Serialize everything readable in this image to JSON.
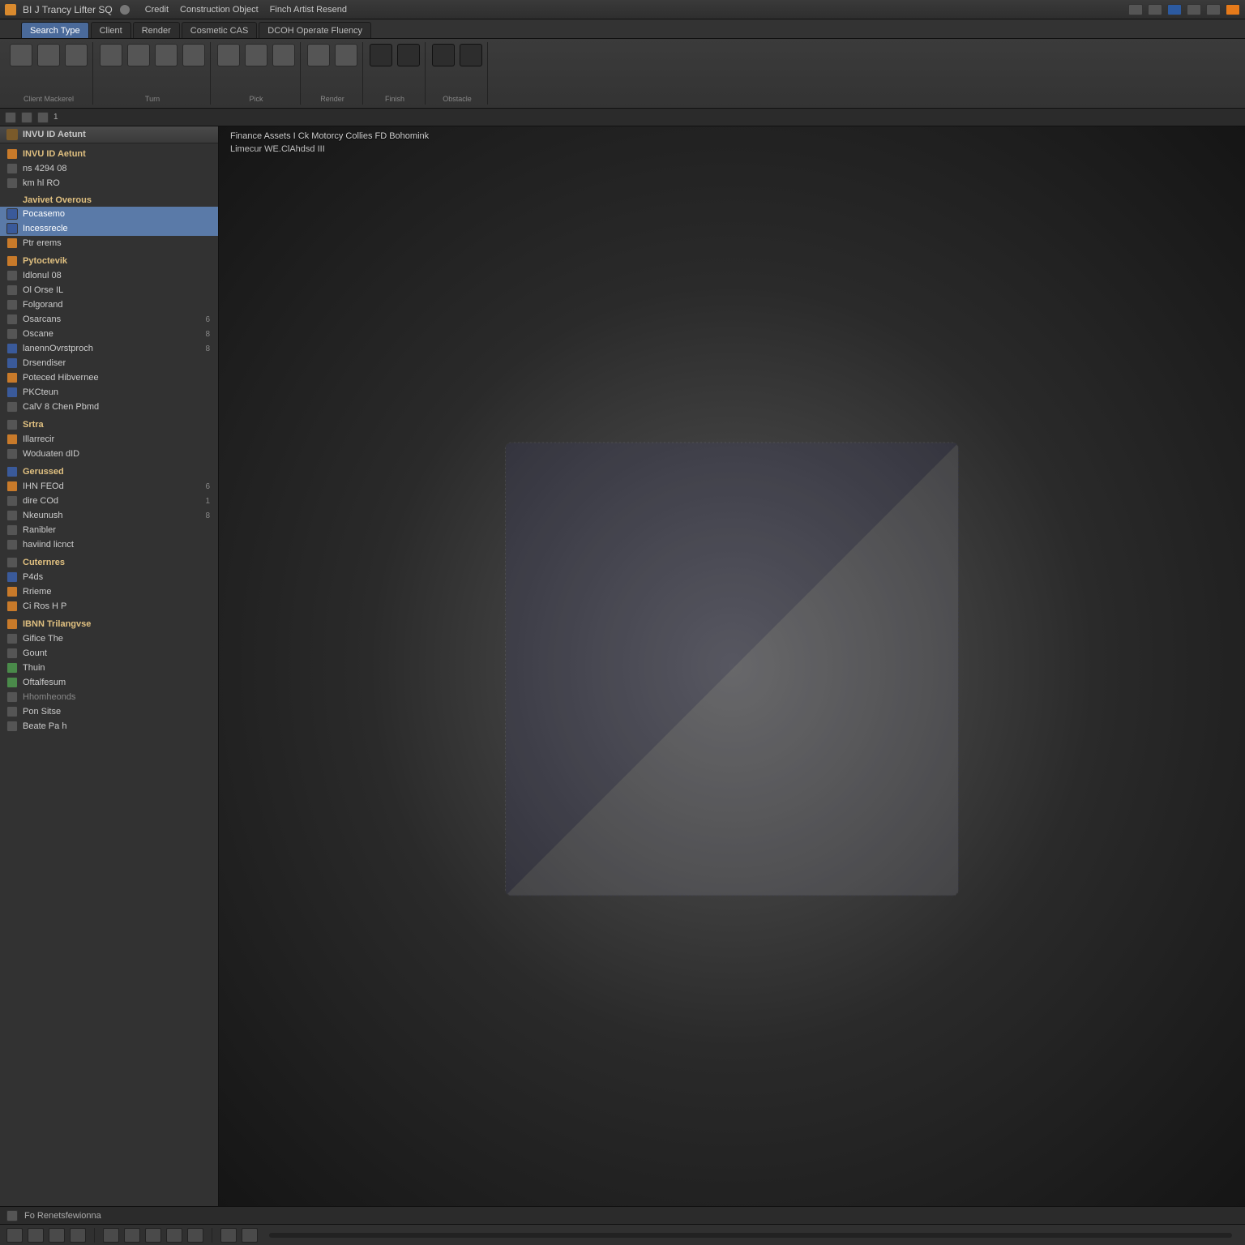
{
  "title_bar": {
    "app_left": "BI J Trancy Lifter SQ",
    "menus": [
      "Credit",
      "Construction Object",
      "Finch Artist Resend"
    ]
  },
  "ribbon_tabs": {
    "tabs": [
      "Search Type",
      "Client",
      "Render",
      "Cosmetic CAS",
      "DCOH Operate Fluency"
    ],
    "active_index": 0
  },
  "ribbon_groups": [
    {
      "label": "Client Mackerel",
      "icons": 3
    },
    {
      "label": "Turn",
      "icons": 4
    },
    {
      "label": "Pick",
      "icons": 3
    },
    {
      "label": "Render",
      "icons": 2
    },
    {
      "label": "Finish",
      "icons": 2
    },
    {
      "label": "Obstacle",
      "icons": 2
    }
  ],
  "sub_header": {
    "crumbs": [
      "1"
    ]
  },
  "viewport": {
    "doc_title": "Finance Assets I Ck Motorcy Collies FD Bohomink",
    "doc_subtitle": "Limecur WE.ClAhdsd III"
  },
  "panel": {
    "header": "INVU ID Aetunt",
    "items": [
      {
        "label": "INVU ID Aetunt",
        "icon": "orange",
        "kind": "header"
      },
      {
        "label": "ns 4294 08",
        "icon": "grey"
      },
      {
        "label": "km hl RO",
        "icon": "grey"
      },
      {
        "label": "Javivet Overous",
        "icon": "none",
        "kind": "section"
      },
      {
        "label": "Pocasemo",
        "icon": "blue",
        "selected": true
      },
      {
        "label": "Incessrecle",
        "icon": "blue",
        "selected": true
      },
      {
        "label": "Ptr erems",
        "icon": "orange"
      },
      {
        "label": "Pytoctevik",
        "icon": "orange",
        "kind": "section"
      },
      {
        "label": "Idlonul 08",
        "icon": "grey"
      },
      {
        "label": "Ol Orse IL",
        "icon": "grey"
      },
      {
        "label": "Folgorand",
        "icon": "grey"
      },
      {
        "label": "Osarcans",
        "icon": "grey",
        "count": "6"
      },
      {
        "label": "Oscane",
        "icon": "grey",
        "count": "8"
      },
      {
        "label": "lanennOvrstproch",
        "icon": "blue",
        "count": "8"
      },
      {
        "label": "Drsendiser",
        "icon": "blue"
      },
      {
        "label": "Poteced Hibvernee",
        "icon": "orange"
      },
      {
        "label": "PKCteun",
        "icon": "blue"
      },
      {
        "label": "CalV 8 Chen Pbmd",
        "icon": "grey"
      },
      {
        "label": "Srtra",
        "icon": "grey",
        "kind": "section"
      },
      {
        "label": "Illarrecir",
        "icon": "orange"
      },
      {
        "label": "Woduaten dID",
        "icon": "grey"
      },
      {
        "label": "Gerussed",
        "icon": "blue",
        "kind": "section"
      },
      {
        "label": "IHN FEOd",
        "icon": "orange",
        "count": "6"
      },
      {
        "label": "dire COd",
        "icon": "grey",
        "count": "1"
      },
      {
        "label": "Nkeunush",
        "icon": "grey",
        "count": "8"
      },
      {
        "label": "Ranibler",
        "icon": "grey"
      },
      {
        "label": "haviind licnct",
        "icon": "grey"
      },
      {
        "label": "Cuternres",
        "icon": "grey",
        "kind": "section"
      },
      {
        "label": "P4ds",
        "icon": "blue"
      },
      {
        "label": "Rrieme",
        "icon": "orange"
      },
      {
        "label": "Ci Ros H P",
        "icon": "orange"
      },
      {
        "label": "IBNN Trilangvse",
        "icon": "orange",
        "kind": "section"
      },
      {
        "label": "Gifice The",
        "icon": "grey"
      },
      {
        "label": "Gount",
        "icon": "grey"
      },
      {
        "label": "Thuin",
        "icon": "green"
      },
      {
        "label": "Oftalfesum",
        "icon": "green"
      },
      {
        "label": "Hhomheonds",
        "icon": "grey",
        "kind": "section-muted"
      },
      {
        "label": "Pon Sitse",
        "icon": "grey"
      },
      {
        "label": "Beate Pa h",
        "icon": "grey"
      }
    ]
  },
  "status": {
    "message": "Fo Renetsfewionna"
  }
}
